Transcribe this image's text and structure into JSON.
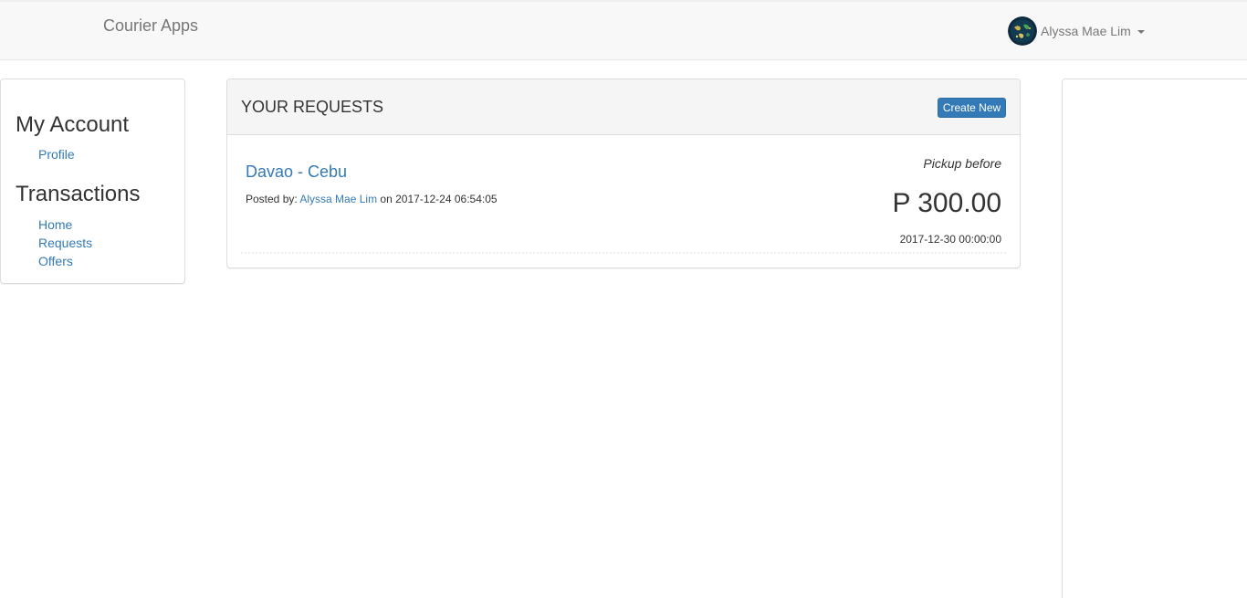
{
  "navbar": {
    "brand": "Courier Apps",
    "user": {
      "name": "Alyssa Mae Lim",
      "avatar_icon": "globe-avatar-icon",
      "dropdown_icon": "caret-down-icon"
    }
  },
  "sidebar": {
    "sections": [
      {
        "heading": "My Account",
        "links": [
          "Profile"
        ]
      },
      {
        "heading": "Transactions",
        "links": [
          "Home",
          "Requests",
          "Offers"
        ]
      }
    ]
  },
  "requests_panel": {
    "title": "YOUR REQUESTS",
    "create_button": "Create New",
    "items": [
      {
        "route": "Davao - Cebu",
        "posted_prefix": "Posted by:",
        "author": "Alyssa Mae Lim",
        "posted_on_prefix": "on",
        "posted_date": "2017-12-24 06:54:05",
        "pickup_label": "Pickup before",
        "price": "P 300.00",
        "pickup_date": "2017-12-30 00:00:00"
      }
    ]
  },
  "colors": {
    "link": "#337ab7",
    "button_primary": "#337ab7",
    "navbar_bg": "#f8f8f8",
    "panel_heading_bg": "#f5f5f5",
    "border": "#dddddd"
  }
}
